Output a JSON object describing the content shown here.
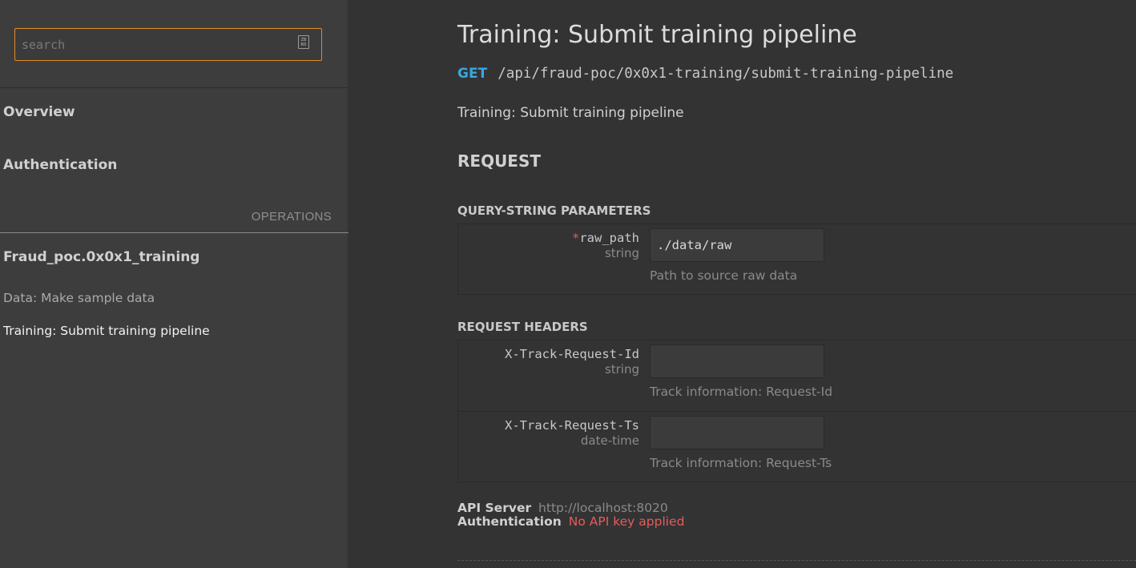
{
  "sidebar": {
    "search": {
      "placeholder": "search",
      "value": "",
      "icon_glyph": "ZB\nRO"
    },
    "sections": [
      {
        "label": "Overview"
      },
      {
        "label": "Authentication"
      }
    ],
    "operations_label": "OPERATIONS",
    "groups": [
      {
        "title": "Fraud_poc.0x0x1_training",
        "items": [
          {
            "label": "Data: Make sample data",
            "active": false
          },
          {
            "label": "Training: Submit training pipeline",
            "active": true
          }
        ]
      }
    ]
  },
  "main": {
    "title": "Training: Submit training pipeline",
    "method": "GET",
    "path": "/api/fraud-poc/0x0x1-training/submit-training-pipeline",
    "description": "Training: Submit training pipeline",
    "request_heading": "REQUEST",
    "query_params": {
      "heading": "QUERY-STRING PARAMETERS",
      "items": [
        {
          "required_mark": "*",
          "name": "raw_path",
          "type": "string",
          "value": "./data/raw",
          "help": "Path to source raw data"
        }
      ]
    },
    "headers": {
      "heading": "REQUEST HEADERS",
      "items": [
        {
          "name": "X-Track-Request-Id",
          "type": "string",
          "value": "",
          "help": "Track information: Request-Id"
        },
        {
          "name": "X-Track-Request-Ts",
          "type": "date-time",
          "value": "",
          "help": "Track information: Request-Ts"
        }
      ]
    },
    "server": {
      "api_server_label": "API Server",
      "api_server_value": "http://localhost:8020",
      "auth_label": "Authentication",
      "auth_value": "No API key applied"
    }
  },
  "colors": {
    "accent_orange": "#e38c26",
    "method_blue": "#3aa6e2",
    "error_red": "#e45c5c"
  }
}
